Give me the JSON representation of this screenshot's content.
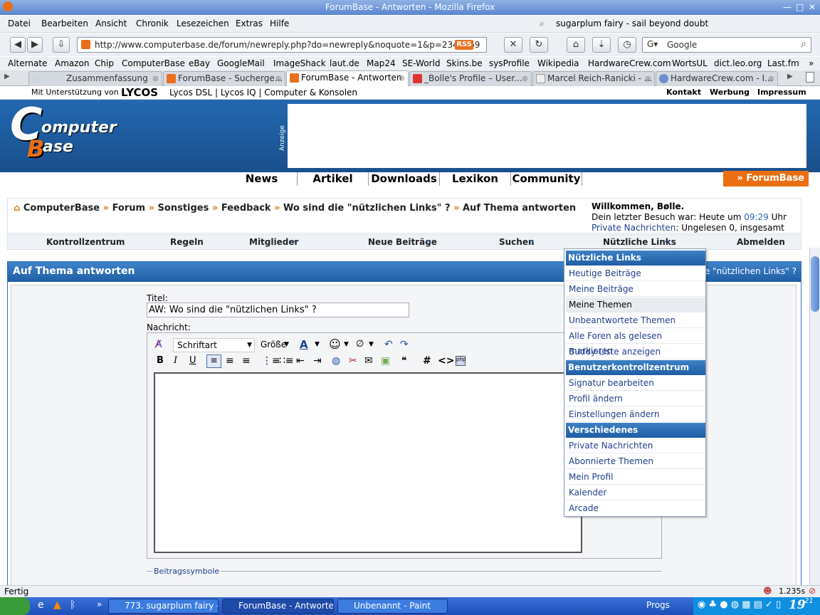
{
  "window": {
    "title": "ForumBase - Antworten - Mozilla Firefox"
  },
  "menubar": {
    "items": [
      "Datei",
      "Bearbeiten",
      "Ansicht",
      "Chronik",
      "Lesezeichen",
      "Extras",
      "Hilfe"
    ],
    "now_playing": "sugarplum fairy - sail beyond doubt"
  },
  "navbar": {
    "url": "http://www.computerbase.de/forum/newreply.php?do=newreply&noquote=1&p=2342969",
    "rss": "RSS",
    "search_engine": "Google",
    "search_placeholder": "Google"
  },
  "bookmarks": [
    "Alternate",
    "Amazon",
    "Chip",
    "ComputerBase",
    "eBay",
    "GoogleMail",
    "ImageShack",
    "laut.de",
    "Map24",
    "SE-World",
    "Skins.be",
    "sysProfile",
    "Wikipedia",
    "HardwareCrew.com",
    "WortsUL",
    "dict.leo.org",
    "Last.fm"
  ],
  "tabs": [
    {
      "label": "Zusammenfassung",
      "active": false
    },
    {
      "label": "ForumBase - Sucherge...",
      "active": false
    },
    {
      "label": "ForumBase - Antworten",
      "active": true
    },
    {
      "label": "_Bolle's Profile – User...",
      "active": false
    },
    {
      "label": "Marcel Reich-Ranicki - ...",
      "active": false
    },
    {
      "label": "HardwareCrew.com - I...",
      "active": false
    }
  ],
  "lycos": {
    "support": "Mit Unterstützung von",
    "brand": "LYCOS",
    "links": "Lycos DSL | Lycos IQ | Computer & Konsolen",
    "right": [
      "Kontakt",
      "Werbung",
      "Impressum"
    ]
  },
  "site": {
    "logo_line1": "C",
    "logo_line2": "omputer",
    "logo_line3": "ase",
    "ad_label": "Anzeige"
  },
  "mainnav": {
    "items": [
      "News",
      "Artikel",
      "Downloads",
      "Lexikon",
      "Community"
    ],
    "forumbase": "» ForumBase"
  },
  "breadcrumb": {
    "items": [
      "ComputerBase",
      "Forum",
      "Sonstiges",
      "Feedback",
      "Wo sind die \"nützlichen Links\" ?",
      "Auf Thema antworten"
    ],
    "sep": "»"
  },
  "welcome": {
    "greeting": "Willkommen, Bølle.",
    "last_visit": "Dein letzter Besuch war: Heute um",
    "time": "09:29",
    "uhr": "Uhr",
    "pm_link": "Private Nachrichten",
    "pm_text": ": Ungelesen 0, insgesamt 187."
  },
  "forumnav": {
    "items": [
      "Kontrollzentrum",
      "Regeln",
      "Mitglieder",
      "Neue Beiträge",
      "Suchen",
      "Nützliche Links",
      "Abmelden"
    ]
  },
  "panel": {
    "title": "Auf Thema antworten",
    "right": "die \"nützlichen Links\" ?"
  },
  "form": {
    "title_label": "Titel:",
    "title_value": "AW: Wo sind die \"nützlichen Links\" ?",
    "message_label": "Nachricht:",
    "font_select": "Schriftart",
    "size_select": "Größe",
    "symbols_label": "Beitragssymbole"
  },
  "dropdown": {
    "sections": [
      {
        "head": "Nützliche Links",
        "items": [
          "Heutige Beiträge",
          "Meine Beiträge",
          "Meine Themen",
          "Unbeantwortete Themen",
          "Alle Foren als gelesen markieren",
          "Buddy-Liste anzeigen"
        ]
      },
      {
        "head": "Benutzerkontrollzentrum",
        "items": [
          "Signatur bearbeiten",
          "Profil ändern",
          "Einstellungen ändern"
        ]
      },
      {
        "head": "Verschiedenes",
        "items": [
          "Private Nachrichten",
          "Abonnierte Themen",
          "Mein Profil",
          "Kalender",
          "Arcade"
        ]
      }
    ],
    "hover_item": "Meine Themen"
  },
  "status": {
    "text": "Fertig",
    "timing": "1.235s"
  },
  "taskbar": {
    "buttons": [
      "773. sugarplum fairy - ...",
      "ForumBase - Antworte...",
      "Unbenannt - Paint"
    ],
    "progs": "Progs",
    "clock": "19",
    "clock_min": "21"
  }
}
